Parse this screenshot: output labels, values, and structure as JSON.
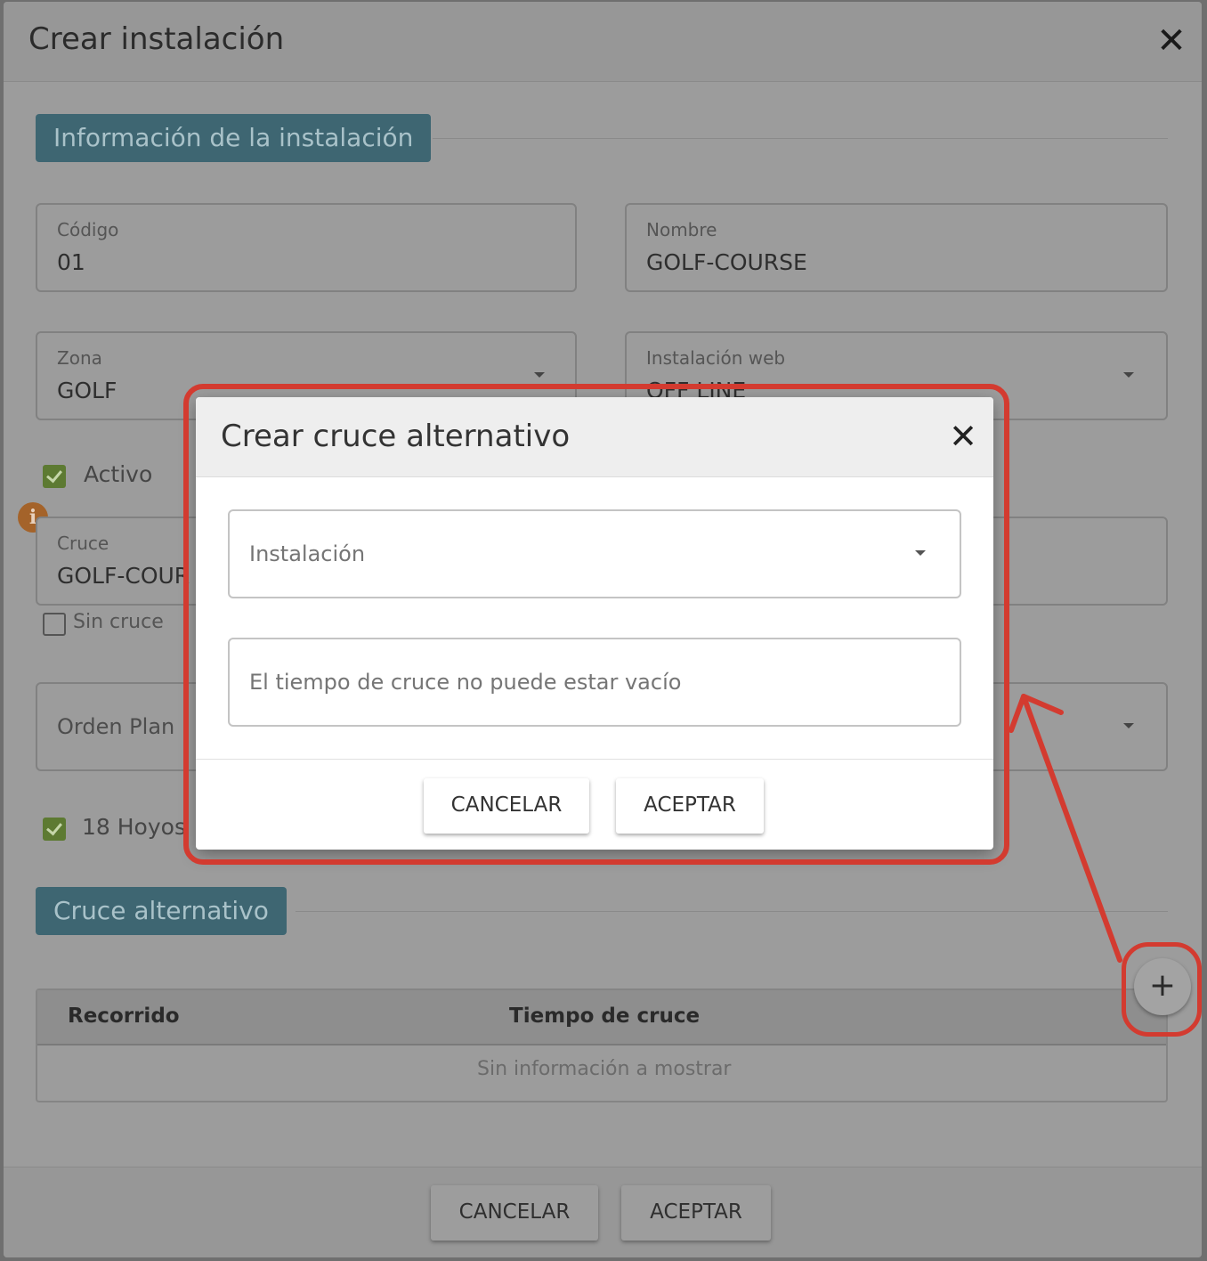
{
  "outer_dialog": {
    "title": "Crear instalación",
    "section_info": "Información de la instalación",
    "fields": {
      "codigo": {
        "label": "Código",
        "value": "01"
      },
      "nombre": {
        "label": "Nombre",
        "value": "GOLF-COURSE"
      },
      "zona": {
        "label": "Zona",
        "value": "GOLF"
      },
      "instalacion_web": {
        "label": "Instalación web",
        "value": "OFF LINE"
      },
      "cruce": {
        "label": "Cruce",
        "value": "GOLF-COUR"
      },
      "orden_plano": {
        "placeholder": "Orden Plan"
      }
    },
    "checkboxes": {
      "activo": {
        "label": "Activo",
        "checked": true
      },
      "sin_cruce": {
        "label": "Sin cruce",
        "checked": false
      },
      "hoyos": {
        "label": "18 Hoyos",
        "checked": true
      }
    },
    "section_alt": "Cruce alternativo",
    "table": {
      "columns": [
        "Recorrido",
        "Tiempo de cruce"
      ],
      "empty_text": "Sin información a mostrar"
    },
    "add_button": "+",
    "cancel_label": "CANCELAR",
    "accept_label": "ACEPTAR"
  },
  "modal": {
    "title": "Crear cruce alternativo",
    "instalacion_placeholder": "Instalación",
    "tiempo_placeholder": "El tiempo de cruce no puede estar vacío",
    "cancel_label": "CANCELAR",
    "accept_label": "ACEPTAR"
  },
  "colors": {
    "annotation": "#d33b30",
    "section_chip": "#3e6672",
    "checkbox_on": "#5d7a32",
    "info_icon": "#a4632a"
  },
  "icons": [
    "close-icon",
    "chevron-down-icon",
    "info-icon",
    "check-icon",
    "plus-icon"
  ]
}
